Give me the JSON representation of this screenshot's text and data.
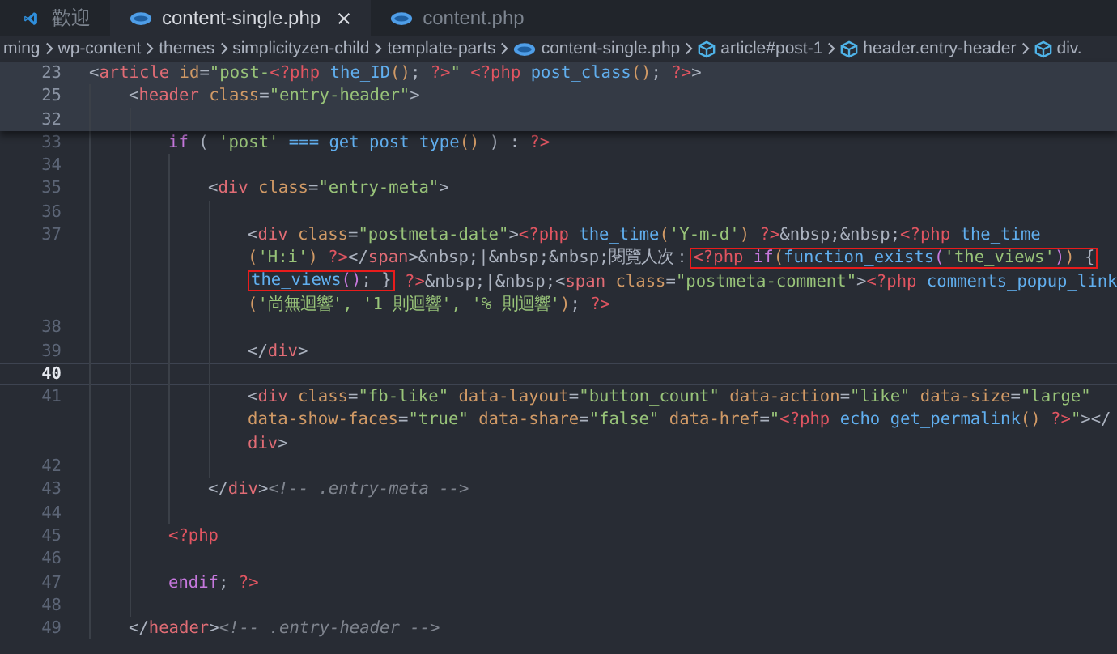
{
  "tabs": [
    {
      "label": "歡迎",
      "selected": false,
      "kind": "welcome"
    },
    {
      "label": "content-single.php",
      "selected": true,
      "kind": "php"
    },
    {
      "label": "content.php",
      "selected": false,
      "kind": "php"
    }
  ],
  "breadcrumbs": [
    {
      "label": "ming",
      "kind": "folder"
    },
    {
      "label": "wp-content",
      "kind": "folder"
    },
    {
      "label": "themes",
      "kind": "folder"
    },
    {
      "label": "simplicityzen-child",
      "kind": "folder"
    },
    {
      "label": "template-parts",
      "kind": "folder"
    },
    {
      "label": "content-single.php",
      "kind": "php"
    },
    {
      "label": "article#post-1",
      "kind": "symbol"
    },
    {
      "label": "header.entry-header",
      "kind": "symbol"
    },
    {
      "label": "div.",
      "kind": "symbol"
    }
  ],
  "code": [
    {
      "number": "23",
      "sticky": true,
      "current": false,
      "rows": [
        {
          "segments": [
            {
              "boxed": false,
              "tokens": [
                {
                  "text": "<",
                  "kind": "plain"
                },
                {
                  "text": "article",
                  "kind": "tag"
                },
                {
                  "text": " id",
                  "kind": "attr"
                },
                {
                  "text": "=",
                  "kind": "plain"
                },
                {
                  "text": "\"post-",
                  "kind": "string"
                },
                {
                  "text": "<?php",
                  "kind": "php"
                },
                {
                  "text": " the_ID",
                  "kind": "function"
                },
                {
                  "text": "()",
                  "kind": "paren"
                },
                {
                  "text": "; ",
                  "kind": "plain"
                },
                {
                  "text": "?>",
                  "kind": "php"
                },
                {
                  "text": "\"",
                  "kind": "string"
                },
                {
                  "text": " <?php",
                  "kind": "php"
                },
                {
                  "text": " post_class",
                  "kind": "function"
                },
                {
                  "text": "()",
                  "kind": "paren"
                },
                {
                  "text": "; ",
                  "kind": "plain"
                },
                {
                  "text": "?>",
                  "kind": "php"
                },
                {
                  "text": ">",
                  "kind": "plain"
                }
              ]
            }
          ]
        }
      ],
      "children": [
        {
          "number": "25",
          "sticky": true,
          "current": false,
          "rows": [
            {
              "segments": [
                {
                  "boxed": false,
                  "tokens": [
                    {
                      "text": "<",
                      "kind": "plain"
                    },
                    {
                      "text": "header",
                      "kind": "tag"
                    },
                    {
                      "text": " class",
                      "kind": "attr"
                    },
                    {
                      "text": "=",
                      "kind": "plain"
                    },
                    {
                      "text": "\"entry-header\"",
                      "kind": "string"
                    },
                    {
                      "text": ">",
                      "kind": "plain"
                    }
                  ]
                }
              ]
            }
          ],
          "children": [
            {
              "number": "32",
              "sticky": true,
              "current": false
            },
            {
              "number": "33",
              "sticky": false,
              "current": false,
              "rows": [
                {
                  "segments": [
                    {
                      "boxed": false,
                      "tokens": [
                        {
                          "text": "if",
                          "kind": "keyword"
                        },
                        {
                          "text": " ( ",
                          "kind": "plain"
                        },
                        {
                          "text": "'post'",
                          "kind": "string"
                        },
                        {
                          "text": " === ",
                          "kind": "function"
                        },
                        {
                          "text": "get_post_type",
                          "kind": "function"
                        },
                        {
                          "text": "()",
                          "kind": "paren"
                        },
                        {
                          "text": " ) : ",
                          "kind": "plain"
                        },
                        {
                          "text": "?>",
                          "kind": "php"
                        }
                      ]
                    }
                  ]
                }
              ],
              "children": [
                {
                  "number": "34",
                  "sticky": false,
                  "current": false
                },
                {
                  "number": "35",
                  "sticky": false,
                  "current": false,
                  "rows": [
                    {
                      "segments": [
                        {
                          "boxed": false,
                          "tokens": [
                            {
                              "text": "<",
                              "kind": "plain"
                            },
                            {
                              "text": "div",
                              "kind": "tag"
                            },
                            {
                              "text": " class",
                              "kind": "attr"
                            },
                            {
                              "text": "=",
                              "kind": "plain"
                            },
                            {
                              "text": "\"entry-meta\"",
                              "kind": "string"
                            },
                            {
                              "text": ">",
                              "kind": "plain"
                            }
                          ]
                        }
                      ]
                    }
                  ],
                  "children": [
                    {
                      "number": "36",
                      "sticky": false,
                      "current": false
                    },
                    {
                      "number": "37",
                      "sticky": false,
                      "current": false,
                      "rows": [
                        {
                          "segments": [
                            {
                              "boxed": false,
                              "tokens": [
                                {
                                  "text": "<",
                                  "kind": "plain"
                                },
                                {
                                  "text": "div",
                                  "kind": "tag"
                                },
                                {
                                  "text": " class",
                                  "kind": "attr"
                                },
                                {
                                  "text": "=",
                                  "kind": "plain"
                                },
                                {
                                  "text": "\"postmeta-date\"",
                                  "kind": "string"
                                },
                                {
                                  "text": ">",
                                  "kind": "plain"
                                },
                                {
                                  "text": "<?php",
                                  "kind": "php"
                                },
                                {
                                  "text": " the_time",
                                  "kind": "function"
                                },
                                {
                                  "text": "(",
                                  "kind": "paren"
                                },
                                {
                                  "text": "'Y-m-d'",
                                  "kind": "string"
                                },
                                {
                                  "text": ")",
                                  "kind": "paren"
                                },
                                {
                                  "text": " ?>",
                                  "kind": "php"
                                },
                                {
                                  "text": "&nbsp;&nbsp;",
                                  "kind": "plain"
                                },
                                {
                                  "text": "<?php",
                                  "kind": "php"
                                },
                                {
                                  "text": " the_time",
                                  "kind": "function"
                                }
                              ]
                            }
                          ]
                        },
                        {
                          "segments": [
                            {
                              "boxed": false,
                              "tokens": [
                                {
                                  "text": "(",
                                  "kind": "paren"
                                },
                                {
                                  "text": "'H:i'",
                                  "kind": "string"
                                },
                                {
                                  "text": ")",
                                  "kind": "paren"
                                },
                                {
                                  "text": " ?>",
                                  "kind": "php"
                                },
                                {
                                  "text": "</",
                                  "kind": "plain"
                                },
                                {
                                  "text": "span",
                                  "kind": "tag"
                                },
                                {
                                  "text": ">&nbsp;|&nbsp;&nbsp;閱覽人次：",
                                  "kind": "plain"
                                }
                              ]
                            },
                            {
                              "boxed": true,
                              "tokens": [
                                {
                                  "text": "<?php",
                                  "kind": "php"
                                },
                                {
                                  "text": " if",
                                  "kind": "keyword"
                                },
                                {
                                  "text": "(",
                                  "kind": "paren"
                                },
                                {
                                  "text": "function_exists",
                                  "kind": "function"
                                },
                                {
                                  "text": "(",
                                  "kind": "keyword"
                                },
                                {
                                  "text": "'the_views'",
                                  "kind": "string"
                                },
                                {
                                  "text": ")",
                                  "kind": "keyword"
                                },
                                {
                                  "text": ")",
                                  "kind": "paren"
                                },
                                {
                                  "text": " {",
                                  "kind": "plain"
                                }
                              ]
                            }
                          ]
                        },
                        {
                          "segments": [
                            {
                              "boxed": true,
                              "tokens": [
                                {
                                  "text": "the_views",
                                  "kind": "function"
                                },
                                {
                                  "text": "()",
                                  "kind": "keyword"
                                },
                                {
                                  "text": "; }",
                                  "kind": "plain"
                                }
                              ]
                            },
                            {
                              "boxed": false,
                              "tokens": [
                                {
                                  "text": " ?>",
                                  "kind": "php"
                                },
                                {
                                  "text": "&nbsp;|&nbsp;<",
                                  "kind": "plain"
                                },
                                {
                                  "text": "span",
                                  "kind": "tag"
                                },
                                {
                                  "text": " class",
                                  "kind": "attr"
                                },
                                {
                                  "text": "=",
                                  "kind": "plain"
                                },
                                {
                                  "text": "\"postmeta-comment\"",
                                  "kind": "string"
                                },
                                {
                                  "text": ">",
                                  "kind": "plain"
                                },
                                {
                                  "text": "<?php",
                                  "kind": "php"
                                },
                                {
                                  "text": " comments_popup_link",
                                  "kind": "function"
                                }
                              ]
                            }
                          ]
                        },
                        {
                          "segments": [
                            {
                              "boxed": false,
                              "tokens": [
                                {
                                  "text": "(",
                                  "kind": "paren"
                                },
                                {
                                  "text": "'尚無迴響', '1 則迴響', '% 則迴響'",
                                  "kind": "string"
                                },
                                {
                                  "text": ")",
                                  "kind": "paren"
                                },
                                {
                                  "text": "; ",
                                  "kind": "plain"
                                },
                                {
                                  "text": "?>",
                                  "kind": "php"
                                }
                              ]
                            }
                          ]
                        }
                      ]
                    },
                    {
                      "number": "38",
                      "sticky": false,
                      "current": false
                    },
                    {
                      "number": "39",
                      "sticky": false,
                      "current": false,
                      "rows": [
                        {
                          "segments": [
                            {
                              "boxed": false,
                              "tokens": [
                                {
                                  "text": "</",
                                  "kind": "plain"
                                },
                                {
                                  "text": "div",
                                  "kind": "tag"
                                },
                                {
                                  "text": ">",
                                  "kind": "plain"
                                }
                              ]
                            }
                          ]
                        }
                      ]
                    },
                    {
                      "number": "40",
                      "sticky": false,
                      "current": true
                    },
                    {
                      "number": "41",
                      "sticky": false,
                      "current": false,
                      "rows": [
                        {
                          "segments": [
                            {
                              "boxed": false,
                              "tokens": [
                                {
                                  "text": "<",
                                  "kind": "plain"
                                },
                                {
                                  "text": "div",
                                  "kind": "tag"
                                },
                                {
                                  "text": " class",
                                  "kind": "attr"
                                },
                                {
                                  "text": "=",
                                  "kind": "plain"
                                },
                                {
                                  "text": "\"fb-like\"",
                                  "kind": "string"
                                },
                                {
                                  "text": " data-layout",
                                  "kind": "attr"
                                },
                                {
                                  "text": "=",
                                  "kind": "plain"
                                },
                                {
                                  "text": "\"button_count\"",
                                  "kind": "string"
                                },
                                {
                                  "text": " data-action",
                                  "kind": "attr"
                                },
                                {
                                  "text": "=",
                                  "kind": "plain"
                                },
                                {
                                  "text": "\"like\"",
                                  "kind": "string"
                                },
                                {
                                  "text": " data-size",
                                  "kind": "attr"
                                },
                                {
                                  "text": "=",
                                  "kind": "plain"
                                },
                                {
                                  "text": "\"large\"",
                                  "kind": "string"
                                }
                              ]
                            }
                          ]
                        },
                        {
                          "segments": [
                            {
                              "boxed": false,
                              "tokens": [
                                {
                                  "text": "data-show-faces",
                                  "kind": "attr"
                                },
                                {
                                  "text": "=",
                                  "kind": "plain"
                                },
                                {
                                  "text": "\"true\"",
                                  "kind": "string"
                                },
                                {
                                  "text": " data-share",
                                  "kind": "attr"
                                },
                                {
                                  "text": "=",
                                  "kind": "plain"
                                },
                                {
                                  "text": "\"false\"",
                                  "kind": "string"
                                },
                                {
                                  "text": " data-href",
                                  "kind": "attr"
                                },
                                {
                                  "text": "=",
                                  "kind": "plain"
                                },
                                {
                                  "text": "\"",
                                  "kind": "string"
                                },
                                {
                                  "text": "<?php",
                                  "kind": "php"
                                },
                                {
                                  "text": " echo get_permalink",
                                  "kind": "function"
                                },
                                {
                                  "text": "()",
                                  "kind": "paren"
                                },
                                {
                                  "text": " ?>",
                                  "kind": "php"
                                },
                                {
                                  "text": "\"",
                                  "kind": "string"
                                },
                                {
                                  "text": "></",
                                  "kind": "plain"
                                }
                              ]
                            }
                          ]
                        },
                        {
                          "segments": [
                            {
                              "boxed": false,
                              "tokens": [
                                {
                                  "text": "div",
                                  "kind": "tag"
                                },
                                {
                                  "text": ">",
                                  "kind": "plain"
                                }
                              ]
                            }
                          ]
                        }
                      ]
                    },
                    {
                      "number": "42",
                      "sticky": false,
                      "current": false
                    }
                  ]
                },
                {
                  "number": "43",
                  "sticky": false,
                  "current": false,
                  "rows": [
                    {
                      "segments": [
                        {
                          "boxed": false,
                          "tokens": [
                            {
                              "text": "</",
                              "kind": "plain"
                            },
                            {
                              "text": "div",
                              "kind": "tag"
                            },
                            {
                              "text": ">",
                              "kind": "plain"
                            },
                            {
                              "text": "<!-- .entry-meta -->",
                              "kind": "comment"
                            }
                          ]
                        }
                      ]
                    }
                  ]
                },
                {
                  "number": "44",
                  "sticky": false,
                  "current": false
                }
              ]
            },
            {
              "number": "45",
              "sticky": false,
              "current": false,
              "rows": [
                {
                  "segments": [
                    {
                      "boxed": false,
                      "tokens": [
                        {
                          "text": "<?php",
                          "kind": "php"
                        }
                      ]
                    }
                  ]
                }
              ]
            },
            {
              "number": "46",
              "sticky": false,
              "current": false
            },
            {
              "number": "47",
              "sticky": false,
              "current": false,
              "rows": [
                {
                  "segments": [
                    {
                      "boxed": false,
                      "tokens": [
                        {
                          "text": "endif",
                          "kind": "keyword"
                        },
                        {
                          "text": "; ",
                          "kind": "plain"
                        },
                        {
                          "text": "?>",
                          "kind": "php"
                        }
                      ]
                    }
                  ]
                }
              ]
            },
            {
              "number": "48",
              "sticky": false,
              "current": false
            }
          ]
        },
        {
          "number": "49",
          "sticky": false,
          "current": false,
          "rows": [
            {
              "segments": [
                {
                  "boxed": false,
                  "tokens": [
                    {
                      "text": "</",
                      "kind": "plain"
                    },
                    {
                      "text": "header",
                      "kind": "tag"
                    },
                    {
                      "text": ">",
                      "kind": "plain"
                    },
                    {
                      "text": "<!-- .entry-header -->",
                      "kind": "comment"
                    }
                  ]
                }
              ]
            }
          ]
        }
      ]
    }
  ]
}
